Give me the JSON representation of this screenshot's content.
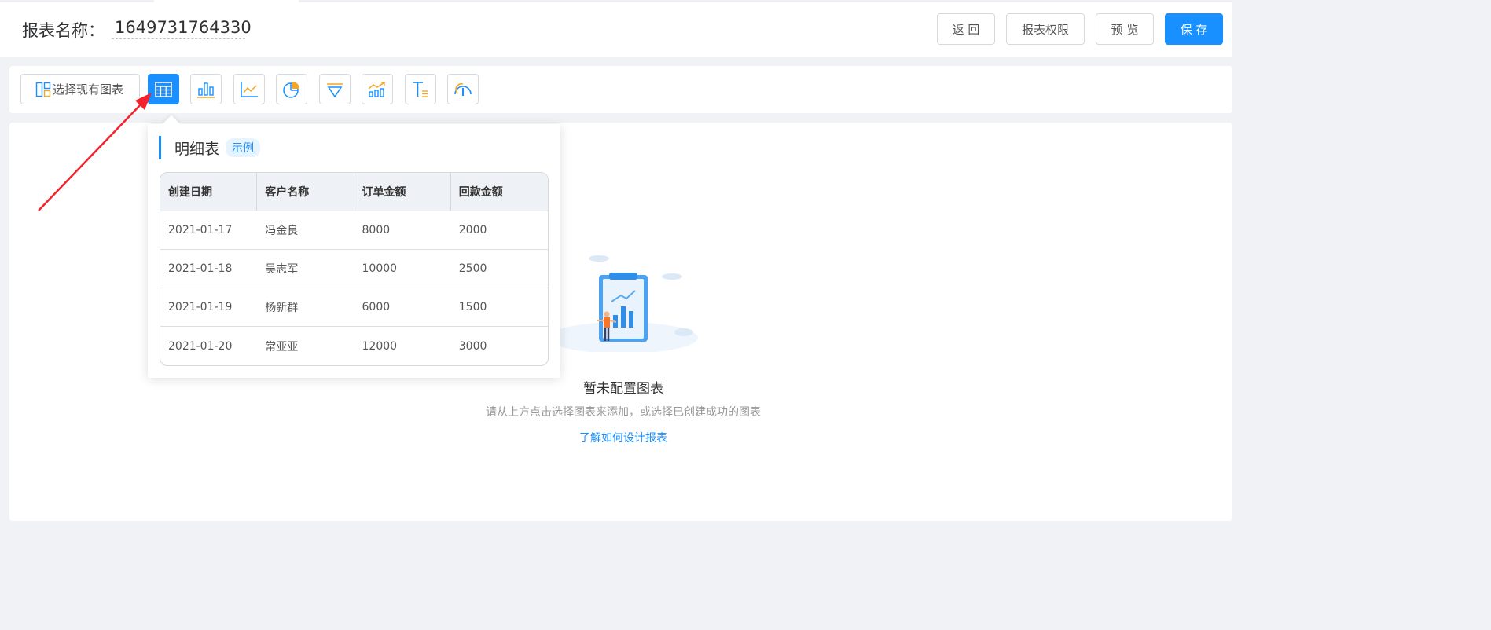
{
  "header": {
    "title_label": "报表名称：",
    "title_value": "1649731764330",
    "buttons": {
      "back": "返 回",
      "permission": "报表权限",
      "preview": "预 览",
      "save": "保 存"
    }
  },
  "toolbar": {
    "select_existing_label": "选择现有图表",
    "chart_types": [
      "table-chart-icon",
      "bar-chart-icon",
      "line-chart-icon",
      "pie-chart-icon",
      "funnel-chart-icon",
      "combo-chart-icon",
      "text-icon",
      "gauge-chart-icon"
    ]
  },
  "popover": {
    "title": "明细表",
    "tag": "示例",
    "columns": [
      "创建日期",
      "客户名称",
      "订单金额",
      "回款金额"
    ],
    "rows": [
      [
        "2021-01-17",
        "冯金良",
        "8000",
        "2000"
      ],
      [
        "2021-01-18",
        "吴志军",
        "10000",
        "2500"
      ],
      [
        "2021-01-19",
        "杨新群",
        "6000",
        "1500"
      ],
      [
        "2021-01-20",
        "常亚亚",
        "12000",
        "3000"
      ]
    ]
  },
  "empty": {
    "title": "暂未配置图表",
    "description": "请从上方点击选择图表来添加，或选择已创建成功的图表",
    "link": "了解如何设计报表"
  },
  "colors": {
    "primary": "#1890ff",
    "annotation_arrow": "#f5222d"
  }
}
